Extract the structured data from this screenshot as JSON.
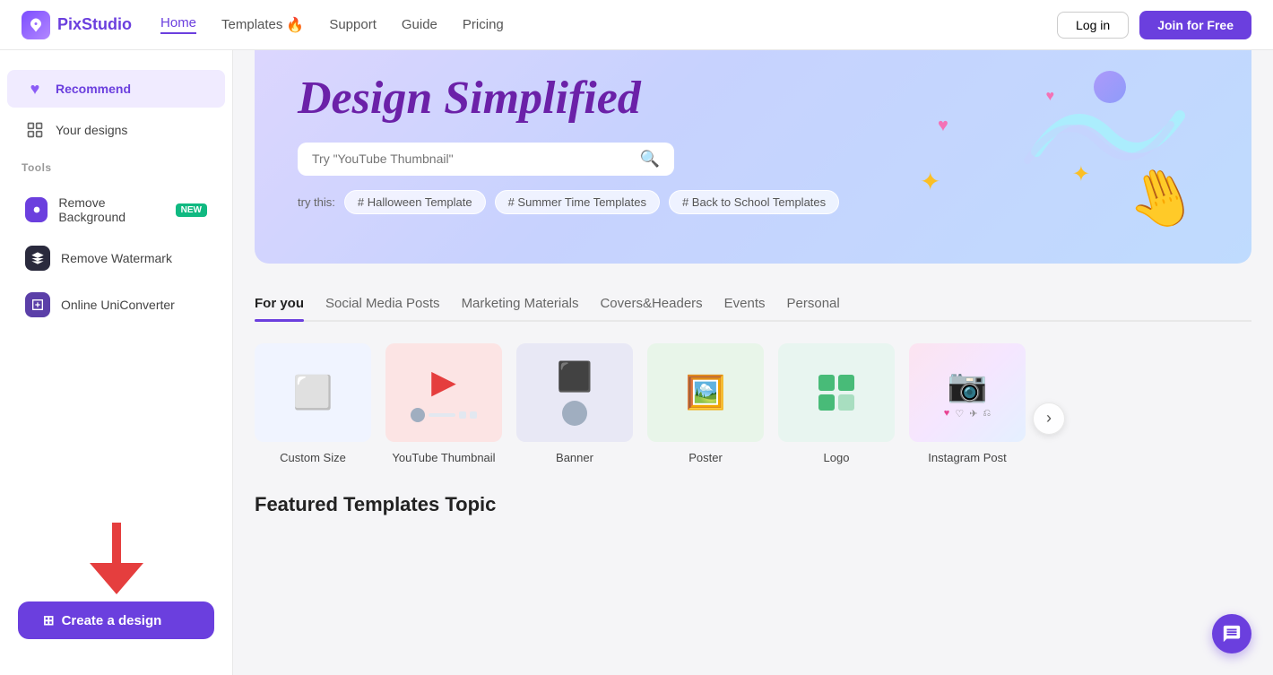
{
  "navbar": {
    "logo_text": "PixStudio",
    "links": [
      {
        "label": "Home",
        "active": true
      },
      {
        "label": "Templates",
        "fire": true
      },
      {
        "label": "Support"
      },
      {
        "label": "Guide"
      },
      {
        "label": "Pricing"
      }
    ],
    "login_label": "Log in",
    "join_label": "Join for Free"
  },
  "sidebar": {
    "recommend_label": "Recommend",
    "your_designs_label": "Your designs",
    "tools_label": "Tools",
    "tools": [
      {
        "label": "Remove Background",
        "badge": "NEW"
      },
      {
        "label": "Remove Watermark"
      },
      {
        "label": "Online UniConverter"
      }
    ],
    "create_btn_label": "Create a design"
  },
  "hero": {
    "title": "Design Simplified",
    "search_placeholder": "Try \"YouTube Thumbnail\"",
    "try_label": "try this:",
    "tags": [
      "# Halloween Template",
      "# Summer Time Templates",
      "# Back to School Templates"
    ]
  },
  "category_tabs": [
    {
      "label": "For you",
      "active": true
    },
    {
      "label": "Social Media Posts"
    },
    {
      "label": "Marketing Materials"
    },
    {
      "label": "Covers&Headers"
    },
    {
      "label": "Events"
    },
    {
      "label": "Personal"
    }
  ],
  "design_cards": [
    {
      "label": "Custom Size",
      "theme": "custom"
    },
    {
      "label": "YouTube Thumbnail",
      "theme": "youtube"
    },
    {
      "label": "Banner",
      "theme": "banner"
    },
    {
      "label": "Poster",
      "theme": "poster"
    },
    {
      "label": "Logo",
      "theme": "logo"
    },
    {
      "label": "Instagram Post",
      "theme": "instagram"
    }
  ],
  "featured_title": "Featured Templates Topic"
}
